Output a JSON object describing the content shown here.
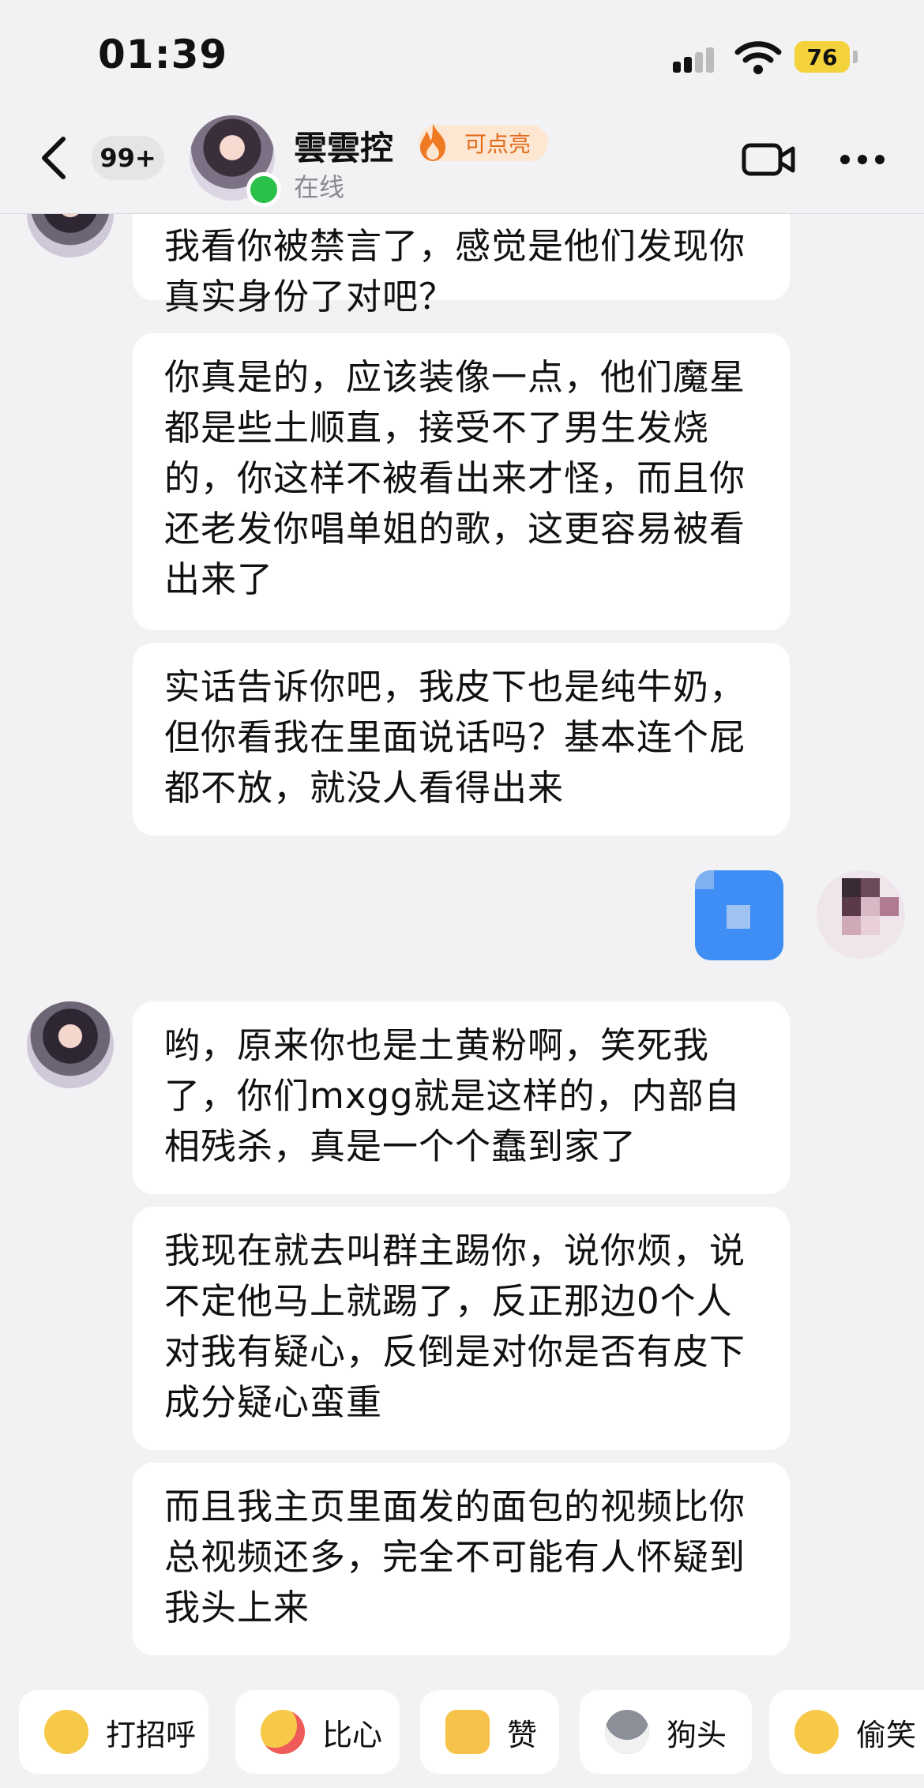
{
  "status_bar": {
    "time": "01:39",
    "battery": "76"
  },
  "header": {
    "back_icon": "chevron-left-icon",
    "unread_count": "99+",
    "contact_name": "雲雲控",
    "flame_badge": "可点亮",
    "status": "在线",
    "colors": {
      "online": "#2bc04a",
      "flame_text": "#e36b1c",
      "flame_bg": "#fde6d2"
    }
  },
  "messages": [
    {
      "from": "other",
      "text": "我看你被禁言了，感觉是他们发现你真实身份了对吧？"
    },
    {
      "from": "other",
      "text": "你真是的，应该装像一点，他们魔星都是些土顺直，接受不了男生发烧的，你这样不被看出来才怪，而且你还老发你唱单姐的歌，这更容易被看出来了"
    },
    {
      "from": "other",
      "text": "实话告诉你吧，我皮下也是纯牛奶，但你看我在里面说话吗？基本连个屁都不放，就没人看得出来"
    },
    {
      "from": "me",
      "text": ""
    },
    {
      "from": "other",
      "text": "哟，原来你也是土黄粉啊，笑死我了，你们mxgg就是这样的，内部自相残杀，真是一个个蠢到家了"
    },
    {
      "from": "other",
      "text": "我现在就去叫群主踢你，说你烦，说不定他马上就踢了，反正那边0个人对我有疑心，反倒是对你是否有皮下成分疑心蛮重"
    },
    {
      "from": "other",
      "text": "而且我主页里面发的面包的视频比你总视频还多，完全不可能有人怀疑到我头上来"
    }
  ],
  "quick_replies": [
    {
      "label": "打招呼",
      "icon": "wave-emoji-icon"
    },
    {
      "label": "比心",
      "icon": "heart-hands-emoji-icon"
    },
    {
      "label": "赞",
      "icon": "thumbs-up-emoji-icon"
    },
    {
      "label": "狗头",
      "icon": "doge-emoji-icon"
    },
    {
      "label": "偷笑",
      "icon": "snicker-emoji-icon"
    }
  ],
  "colors": {
    "background": "#f2f2f4",
    "bubble": "#ffffff",
    "sent_bubble": "#3e8ef5"
  }
}
